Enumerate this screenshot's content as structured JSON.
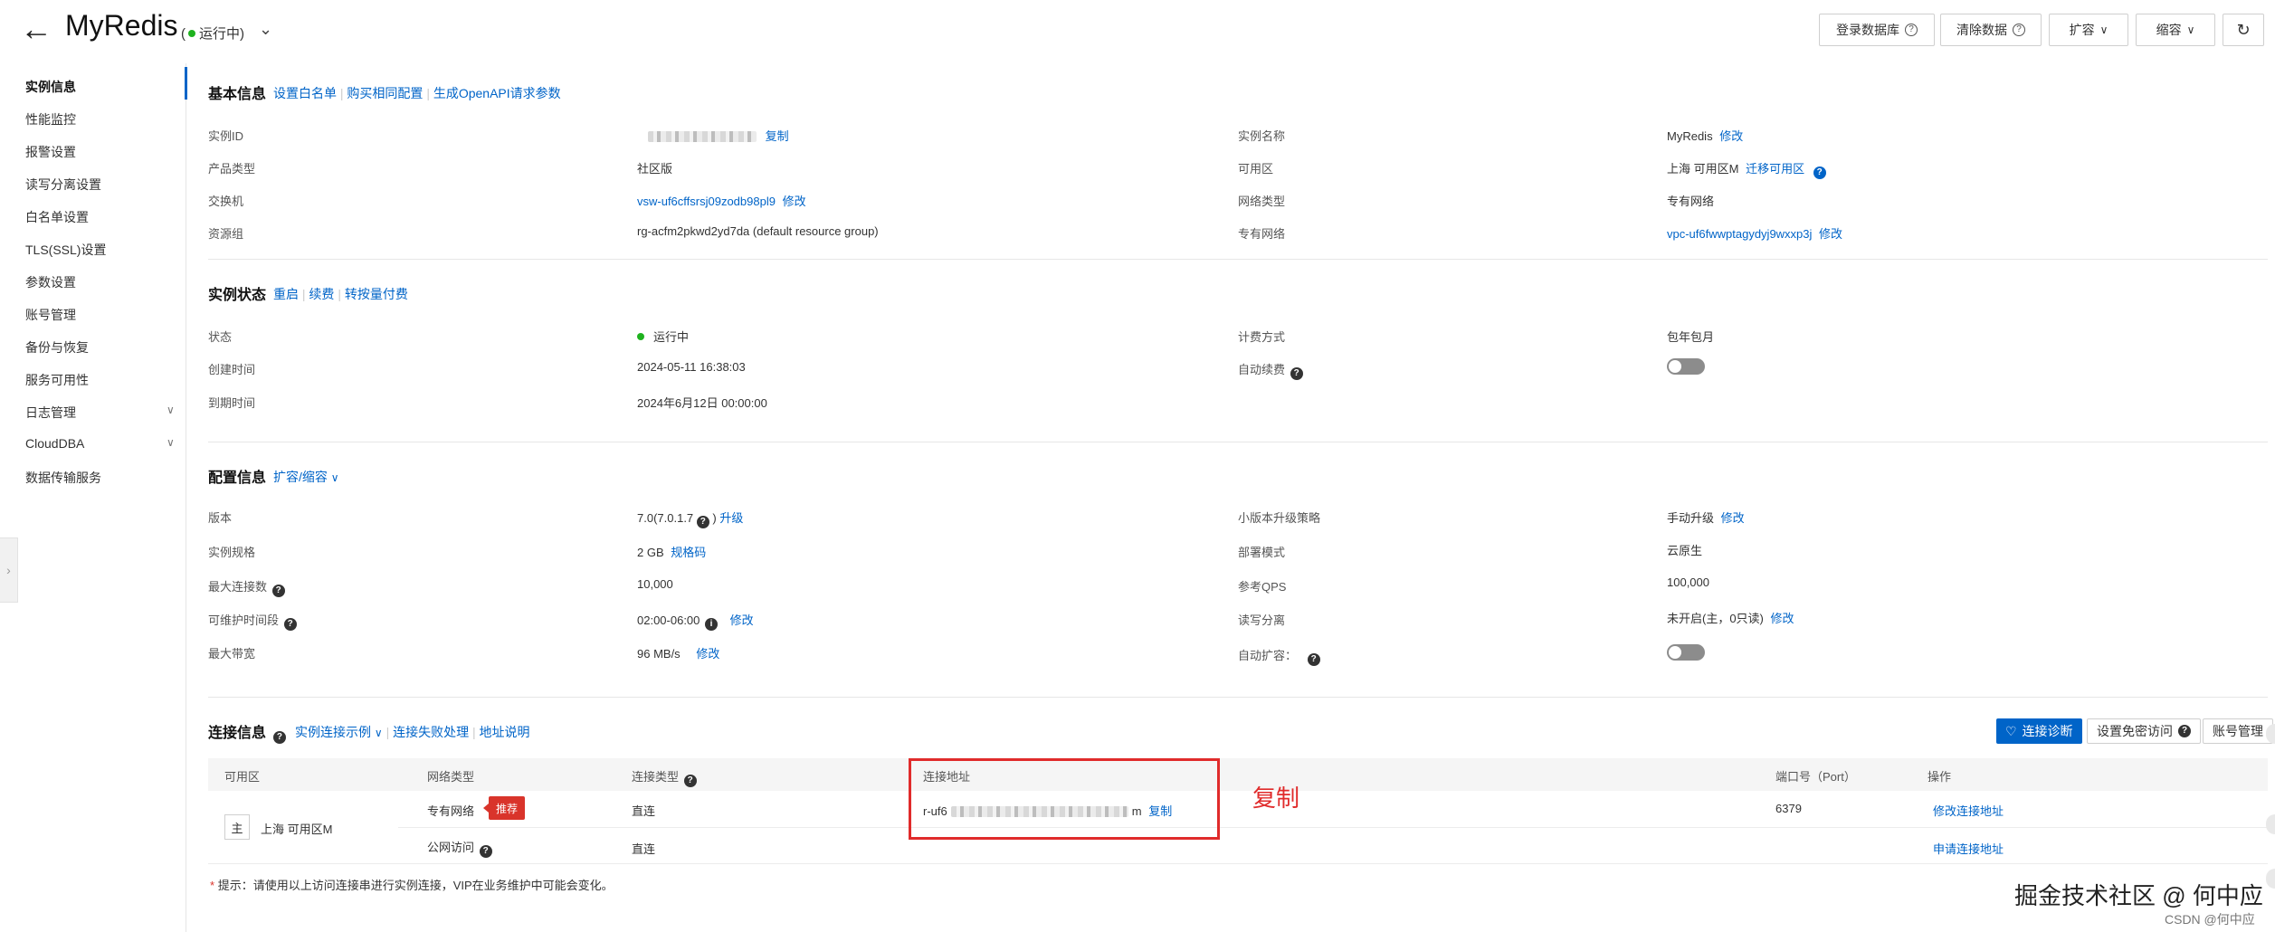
{
  "header": {
    "title": "MyRedis",
    "status_open": "(",
    "status": "运行中)",
    "buttons": {
      "login_db": "登录数据库",
      "clear_data": "清除数据",
      "scale_up": "扩容",
      "scale_down": "缩容"
    },
    "icons": [
      "back-arrow-icon",
      "chevron-down-icon",
      "question-circle-icon",
      "refresh-icon"
    ],
    "accent_color": "#0064c8",
    "status_color": "#1fb21f"
  },
  "sidebar": {
    "items": [
      {
        "label": "实例信息",
        "active": true
      },
      {
        "label": "性能监控"
      },
      {
        "label": "报警设置"
      },
      {
        "label": "读写分离设置"
      },
      {
        "label": "白名单设置"
      },
      {
        "label": "TLS(SSL)设置"
      },
      {
        "label": "参数设置"
      },
      {
        "label": "账号管理"
      },
      {
        "label": "备份与恢复"
      },
      {
        "label": "服务可用性"
      },
      {
        "label": "日志管理",
        "expandable": true
      },
      {
        "label": "CloudDBA",
        "expandable": true
      },
      {
        "label": "数据传输服务"
      }
    ]
  },
  "basic": {
    "title": "基本信息",
    "links": [
      "设置白名单",
      "购买相同配置",
      "生成OpenAPI请求参数"
    ],
    "instance_id_label": "实例ID",
    "copy": "复制",
    "product_type_label": "产品类型",
    "product_type": "社区版",
    "vswitch_label": "交换机",
    "vswitch": "vsw-uf6cffsrsj09zodb98pl9",
    "modify": "修改",
    "resource_group_label": "资源组",
    "resource_group": "rg-acfm2pkwd2yd7da (default resource group)",
    "instance_name_label": "实例名称",
    "instance_name": "MyRedis",
    "zone_label": "可用区",
    "zone": "上海 可用区M",
    "migrate_zone": "迁移可用区",
    "network_type_label": "网络类型",
    "network_type": "专有网络",
    "vpc_label": "专有网络",
    "vpc": "vpc-uf6fwwptagydyj9wxxp3j"
  },
  "status_section": {
    "title": "实例状态",
    "links": [
      "重启",
      "续费",
      "转按量付费"
    ],
    "state_label": "状态",
    "state": "运行中",
    "created_label": "创建时间",
    "created": "2024-05-11 16:38:03",
    "expire_label": "到期时间",
    "expire": "2024年6月12日 00:00:00",
    "billing_label": "计费方式",
    "billing": "包年包月",
    "auto_renew_label": "自动续费",
    "auto_renew_on": false
  },
  "config": {
    "title": "配置信息",
    "scale_link": "扩容/缩容",
    "version_label": "版本",
    "version": "7.0(7.0.1.7",
    "version_close": ")",
    "upgrade": "升级",
    "spec_label": "实例规格",
    "spec": "2 GB",
    "spec_code": "规格码",
    "max_conn_label": "最大连接数",
    "max_conn": "10,000",
    "maint_label": "可维护时间段",
    "maint": "02:00-06:00",
    "bandwidth_label": "最大带宽",
    "bandwidth": "96 MB/s",
    "minor_upgrade_label": "小版本升级策略",
    "minor_upgrade": "手动升级",
    "deploy_label": "部署模式",
    "deploy": "云原生",
    "qps_label": "参考QPS",
    "qps": "100,000",
    "rw_split_label": "读写分离",
    "rw_split": "未开启(主，0只读)",
    "auto_scale_label": "自动扩容：",
    "auto_scale_on": false,
    "modify": "修改"
  },
  "connection": {
    "title": "连接信息",
    "links": [
      "实例连接示例",
      "连接失败处理",
      "地址说明"
    ],
    "buttons": {
      "diagnose": "连接诊断",
      "passwordless": "设置免密访问",
      "accounts": "账号管理"
    },
    "columns": [
      "可用区",
      "网络类型",
      "连接类型",
      "连接地址",
      "端口号（Port）",
      "操作"
    ],
    "zone_badge": "主",
    "zone": "上海 可用区M",
    "rows": [
      {
        "network": "专有网络",
        "tag": "推荐",
        "type": "直连",
        "address_prefix": "r-uf6",
        "address_suffix": "m",
        "copy": "复制",
        "port": "6379",
        "action": "修改连接地址"
      },
      {
        "network": "公网访问",
        "type": "直连",
        "action": "申请连接地址"
      }
    ],
    "annotation": "复制",
    "annotation_color": "#e02b2b"
  },
  "footnote": {
    "star": "*",
    "text": "提示：请使用以上访问连接串进行实例连接，VIP在业务维护中可能会变化。"
  },
  "watermark": {
    "main": "掘金技术社区 @ 何中应",
    "sub": "CSDN @何中应"
  }
}
